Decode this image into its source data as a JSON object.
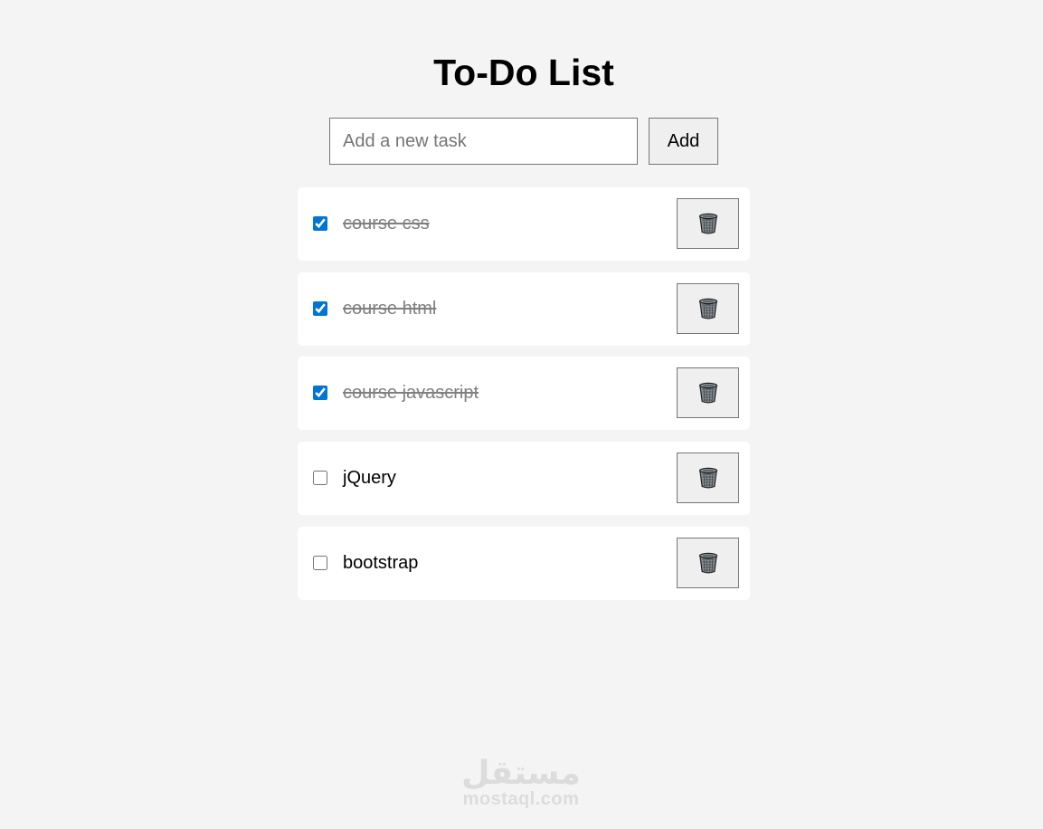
{
  "title": "To-Do List",
  "new_task": {
    "placeholder": "Add a new task",
    "value": "",
    "add_label": "Add"
  },
  "tasks": [
    {
      "label": "course css",
      "done": true
    },
    {
      "label": "course html",
      "done": true
    },
    {
      "label": "course javascript",
      "done": true
    },
    {
      "label": "jQuery",
      "done": false
    },
    {
      "label": "bootstrap",
      "done": false
    }
  ],
  "delete_icon": "trash-icon",
  "watermark": {
    "logo_text": "مستقل",
    "site": "mostaql.com"
  },
  "colors": {
    "background": "#f4f4f4",
    "card": "#ffffff",
    "checkbox_accent": "#0075d5",
    "done_text": "#808080",
    "button_bg": "#efefef"
  }
}
